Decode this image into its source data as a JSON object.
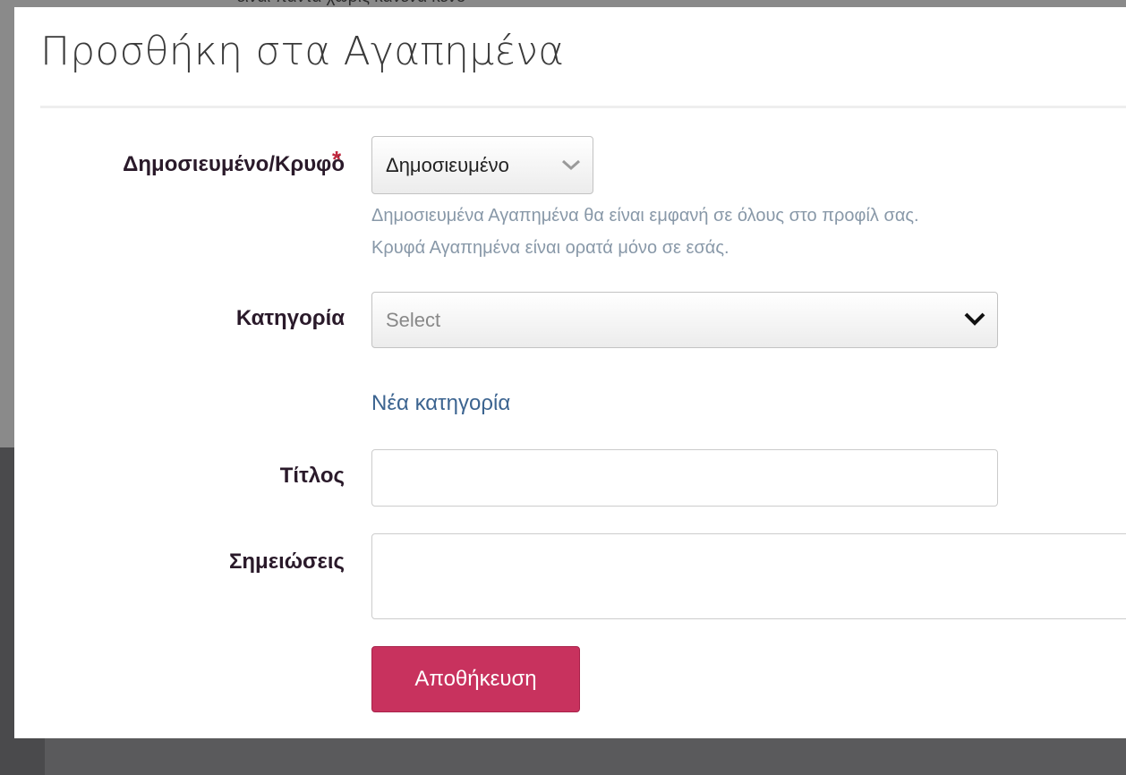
{
  "backdrop": {
    "text": "είναι πάντα χωρίς κανένα κενό"
  },
  "modal": {
    "title": "Προσθήκη στα Αγαπημένα"
  },
  "form": {
    "visibility": {
      "label": "Δημοσιευμένο/Κρυφό",
      "required_mark": "*",
      "selected": "Δημοσιευμένο",
      "help_line1": "Δημοσιευμένα Αγαπημένα θα είναι εμφανή σε όλους στο προφίλ σας.",
      "help_line2": "Κρυφά Αγαπημένα είναι ορατά μόνο σε εσάς."
    },
    "category": {
      "label": "Κατηγορία",
      "placeholder": "Select",
      "new_category_link": "Νέα κατηγορία"
    },
    "title_field": {
      "label": "Τίτλος",
      "value": ""
    },
    "notes_field": {
      "label": "Σημειώσεις",
      "value": ""
    },
    "save_label": "Αποθήκευση"
  },
  "colors": {
    "primary_button": "#c8325e",
    "link": "#3c6490",
    "required": "#c0283e",
    "help_text": "#8898a8"
  },
  "icons": {
    "visibility_select": "chevron-down-icon",
    "category_select": "chevron-down-icon"
  }
}
